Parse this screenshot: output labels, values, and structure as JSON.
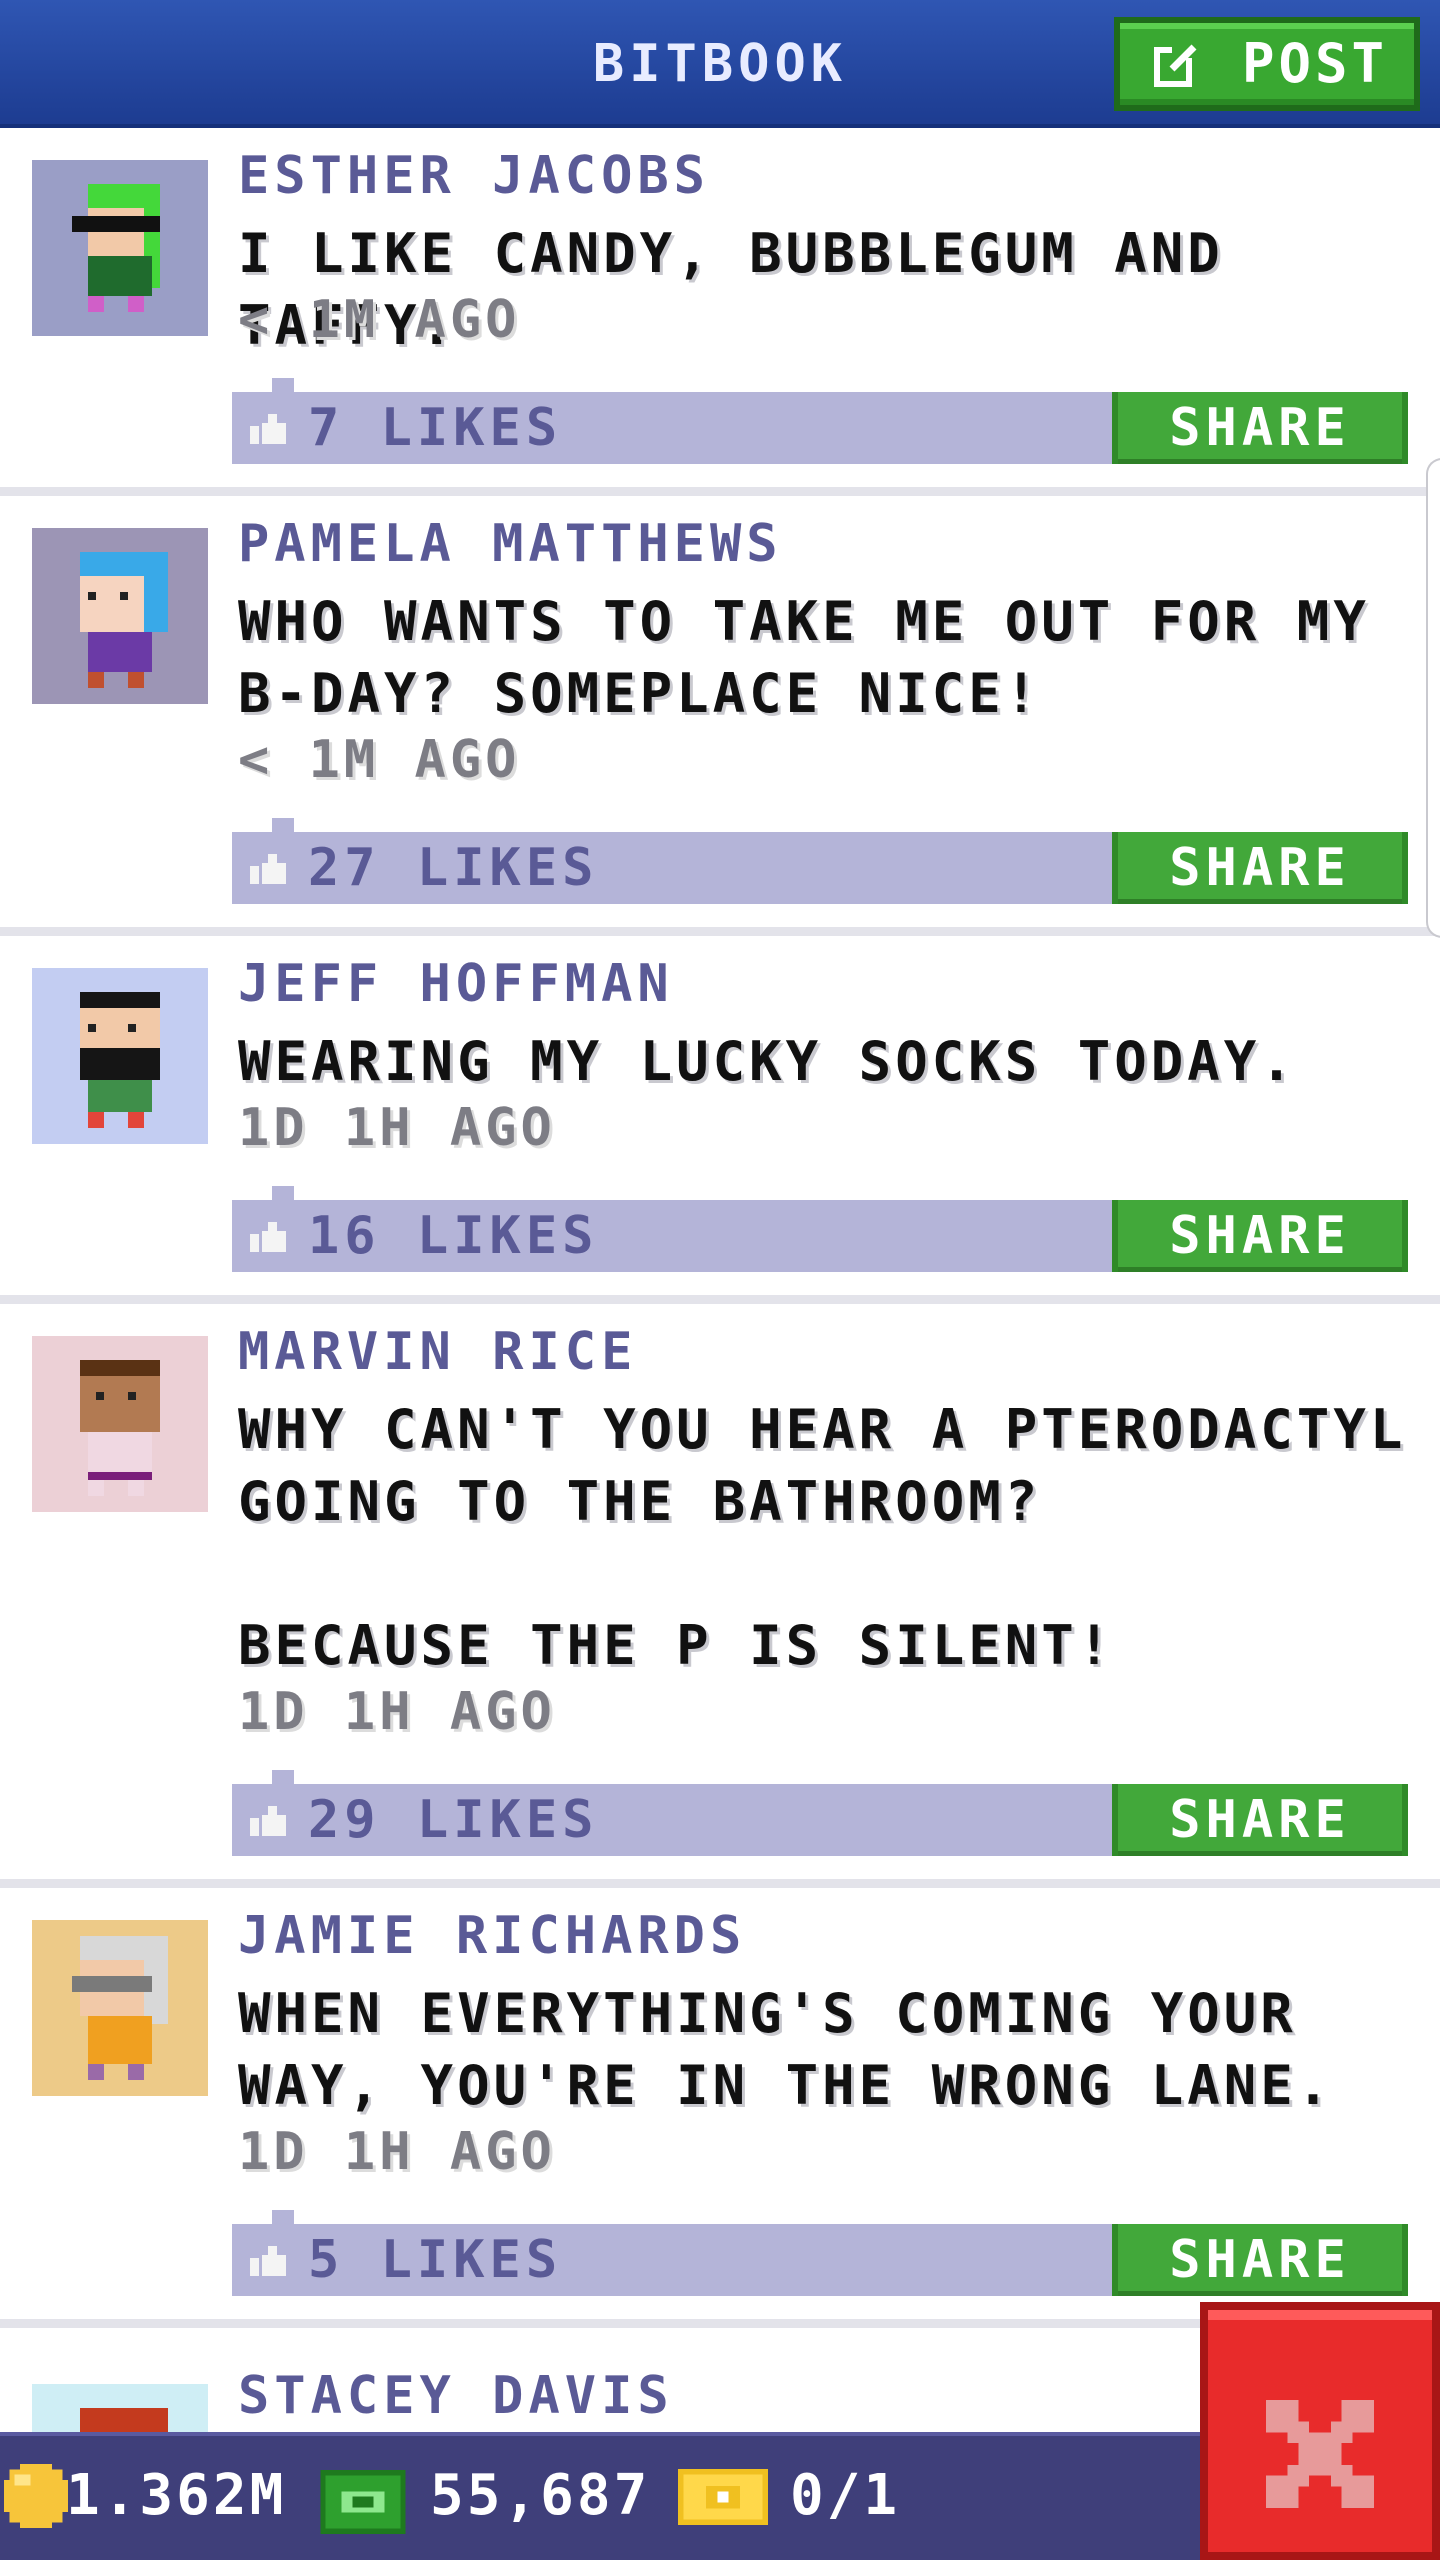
{
  "header": {
    "title": "BITBOOK",
    "post_label": "POST"
  },
  "posts": [
    {
      "name": "ESTHER JACOBS",
      "text": "I LIKE CANDY, BUBBLEGUM AND TAFFY.",
      "time": "< 1M AGO",
      "likes": "7 LIKES",
      "share": "SHARE",
      "avatar_bg": "#9a9ec6"
    },
    {
      "name": "PAMELA MATTHEWS",
      "text": "WHO WANTS TO TAKE ME OUT FOR MY\nB-DAY? SOMEPLACE NICE!",
      "time": "< 1M AGO",
      "likes": "27 LIKES",
      "share": "SHARE",
      "avatar_bg": "#9c95b5"
    },
    {
      "name": "JEFF HOFFMAN",
      "text": "WEARING MY LUCKY SOCKS TODAY.",
      "time": "1D 1H AGO",
      "likes": "16 LIKES",
      "share": "SHARE",
      "avatar_bg": "#c3cdf2"
    },
    {
      "name": "MARVIN RICE",
      "text": "WHY CAN'T YOU HEAR A PTERODACTYL\nGOING TO THE BATHROOM?\n\nBECAUSE THE P IS SILENT!",
      "time": "1D 1H AGO",
      "likes": "29 LIKES",
      "share": "SHARE",
      "avatar_bg": "#ecd0d6"
    },
    {
      "name": "JAMIE RICHARDS",
      "text": "WHEN EVERYTHING'S COMING YOUR\nWAY, YOU'RE IN THE WRONG LANE.",
      "time": "1D 1H AGO",
      "likes": "5 LIKES",
      "share": "SHARE",
      "avatar_bg": "#edca88"
    },
    {
      "name": "STACEY DAVIS",
      "text": "",
      "time": "",
      "likes": "",
      "share": "",
      "avatar_bg": "#cfeef5"
    }
  ],
  "bottom_bar": {
    "coins": "1.362M",
    "bux": "55,687",
    "tickets": "0/1"
  },
  "colors": {
    "header_blue": "#2f56b3",
    "accent_green": "#42a83a",
    "like_bar": "#b4b4d8",
    "name_purple": "#5a5a96",
    "close_red": "#e82b2b"
  },
  "icons": {
    "post": "edit-icon",
    "like": "thumbs-up-icon",
    "coin": "coin-icon",
    "bux": "bux-icon",
    "ticket": "ticket-icon",
    "close": "close-icon"
  }
}
